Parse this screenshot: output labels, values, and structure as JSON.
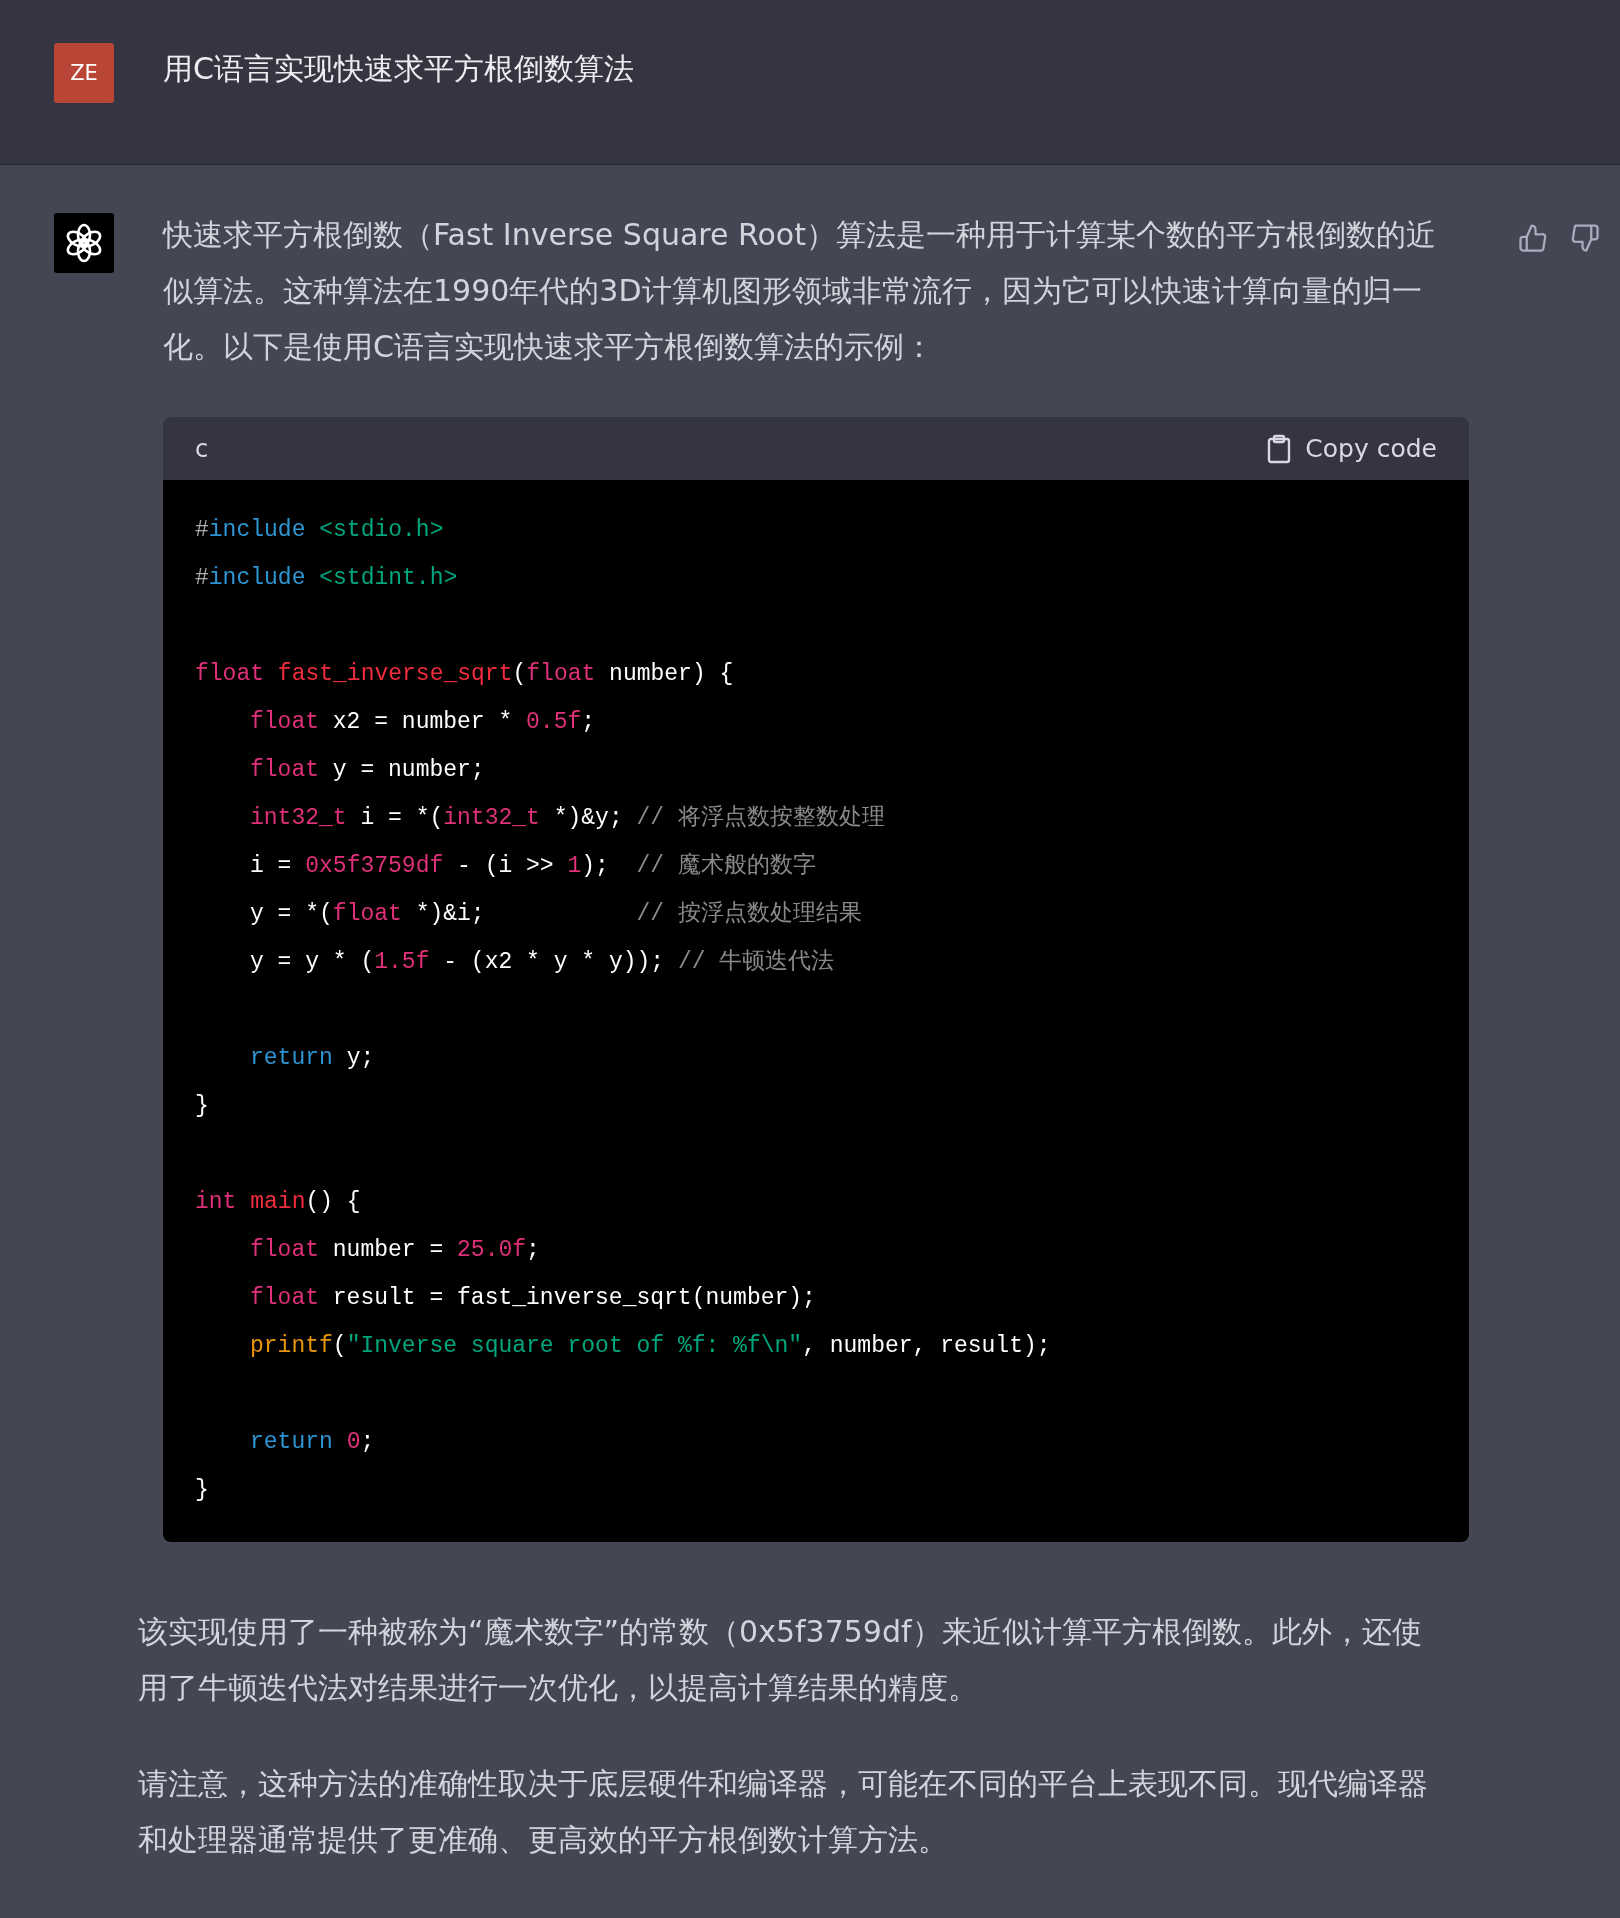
{
  "question": {
    "avatar": "ZE",
    "text": "用C语言实现快速求平方根倒数算法"
  },
  "answer": {
    "intro": "快速求平方根倒数（Fast Inverse Square Root）算法是一种用于计算某个数的平方根倒数的近似算法。这种算法在1990年代的3D计算机图形领域非常流行，因为它可以快速计算向量的归一化。以下是使用C语言实现快速求平方根倒数算法的示例：",
    "code_block": {
      "language": "c",
      "copy_label": "Copy code",
      "lines": [
        {
          "blank_before": false,
          "indented": false,
          "tokens": [
            {
              "text": "#",
              "kind": "plain_dim"
            },
            {
              "text": "include",
              "kind": "builtin"
            },
            {
              "text": " <stdio.h>",
              "kind": "string"
            }
          ]
        },
        {
          "blank_before": false,
          "indented": false,
          "tokens": [
            {
              "text": "#",
              "kind": "plain_dim"
            },
            {
              "text": "include",
              "kind": "builtin"
            },
            {
              "text": " <stdint.h>",
              "kind": "string"
            }
          ]
        },
        {
          "blank_before": true,
          "indented": false,
          "tokens": [
            {
              "text": "float ",
              "kind": "keyword"
            },
            {
              "text": "fast_inverse_sqrt",
              "kind": "function"
            },
            {
              "text": "(",
              "kind": "plain"
            },
            {
              "text": "float",
              "kind": "keyword"
            },
            {
              "text": " number) {",
              "kind": "plain"
            }
          ]
        },
        {
          "blank_before": false,
          "indented": true,
          "tokens": [
            {
              "text": "float",
              "kind": "keyword"
            },
            {
              "text": " x2 = number * ",
              "kind": "plain"
            },
            {
              "text": "0.5f",
              "kind": "number"
            },
            {
              "text": ";",
              "kind": "plain"
            }
          ]
        },
        {
          "blank_before": false,
          "indented": true,
          "tokens": [
            {
              "text": "float",
              "kind": "keyword"
            },
            {
              "text": " y = number;",
              "kind": "plain"
            }
          ]
        },
        {
          "blank_before": false,
          "indented": true,
          "tokens": [
            {
              "text": "int32_t",
              "kind": "keyword"
            },
            {
              "text": " i = *(",
              "kind": "plain"
            },
            {
              "text": "int32_t",
              "kind": "keyword"
            },
            {
              "text": " *)&y; ",
              "kind": "plain"
            },
            {
              "text": "// 将浮点数按整数处理",
              "kind": "comment"
            }
          ]
        },
        {
          "blank_before": false,
          "indented": true,
          "tokens": [
            {
              "text": "i = ",
              "kind": "plain"
            },
            {
              "text": "0x5f3759df",
              "kind": "number"
            },
            {
              "text": " - (i >> ",
              "kind": "plain"
            },
            {
              "text": "1",
              "kind": "number"
            },
            {
              "text": ");  ",
              "kind": "plain"
            },
            {
              "text": "// 魔术般的数字",
              "kind": "comment"
            }
          ]
        },
        {
          "blank_before": false,
          "indented": true,
          "tokens": [
            {
              "text": "y = *(",
              "kind": "plain"
            },
            {
              "text": "float",
              "kind": "keyword"
            },
            {
              "text": " *)&i;           ",
              "kind": "plain"
            },
            {
              "text": "// 按浮点数处理结果",
              "kind": "comment"
            }
          ]
        },
        {
          "blank_before": false,
          "indented": true,
          "tokens": [
            {
              "text": "y = y * (",
              "kind": "plain"
            },
            {
              "text": "1.5f",
              "kind": "number"
            },
            {
              "text": " - (x2 * y * y)); ",
              "kind": "plain"
            },
            {
              "text": "// 牛顿迭代法",
              "kind": "comment"
            }
          ]
        },
        {
          "blank_before": true,
          "indented": true,
          "tokens": [
            {
              "text": "return",
              "kind": "builtin"
            },
            {
              "text": " y;",
              "kind": "plain"
            }
          ]
        },
        {
          "blank_before": false,
          "indented": false,
          "tokens": [
            {
              "text": "}",
              "kind": "plain"
            }
          ]
        },
        {
          "blank_before": true,
          "indented": false,
          "tokens": [
            {
              "text": "int ",
              "kind": "keyword"
            },
            {
              "text": "main",
              "kind": "function"
            },
            {
              "text": "() {",
              "kind": "plain"
            }
          ]
        },
        {
          "blank_before": false,
          "indented": true,
          "tokens": [
            {
              "text": "float",
              "kind": "keyword"
            },
            {
              "text": " number = ",
              "kind": "plain"
            },
            {
              "text": "25.0f",
              "kind": "number"
            },
            {
              "text": ";",
              "kind": "plain"
            }
          ]
        },
        {
          "blank_before": false,
          "indented": true,
          "tokens": [
            {
              "text": "float",
              "kind": "keyword"
            },
            {
              "text": " result = fast_inverse_sqrt(number);",
              "kind": "plain"
            }
          ]
        },
        {
          "blank_before": false,
          "indented": true,
          "tokens": [
            {
              "text": "printf",
              "kind": "call"
            },
            {
              "text": "(",
              "kind": "plain"
            },
            {
              "text": "\"Inverse square root of %f: %f\\n\"",
              "kind": "string"
            },
            {
              "text": ", number, result);",
              "kind": "plain"
            }
          ]
        },
        {
          "blank_before": true,
          "indented": true,
          "tokens": [
            {
              "text": "return ",
              "kind": "builtin"
            },
            {
              "text": "0",
              "kind": "number"
            },
            {
              "text": ";",
              "kind": "plain"
            }
          ]
        },
        {
          "blank_before": false,
          "indented": false,
          "tokens": [
            {
              "text": "}",
              "kind": "plain"
            }
          ]
        }
      ]
    },
    "paragraphs": [
      "该实现使用了一种被称为“魔术数字”的常数（0x5f3759df）来近似计算平方根倒数。此外，还使用了牛顿迭代法对结果进行一次优化，以提高计算结果的精度。",
      "请注意，这种方法的准确性取决于底层硬件和编译器，可能在不同的平台上表现不同。现代编译器和处理器通常提供了更准确、更高效的平方根倒数计算方法。"
    ]
  }
}
